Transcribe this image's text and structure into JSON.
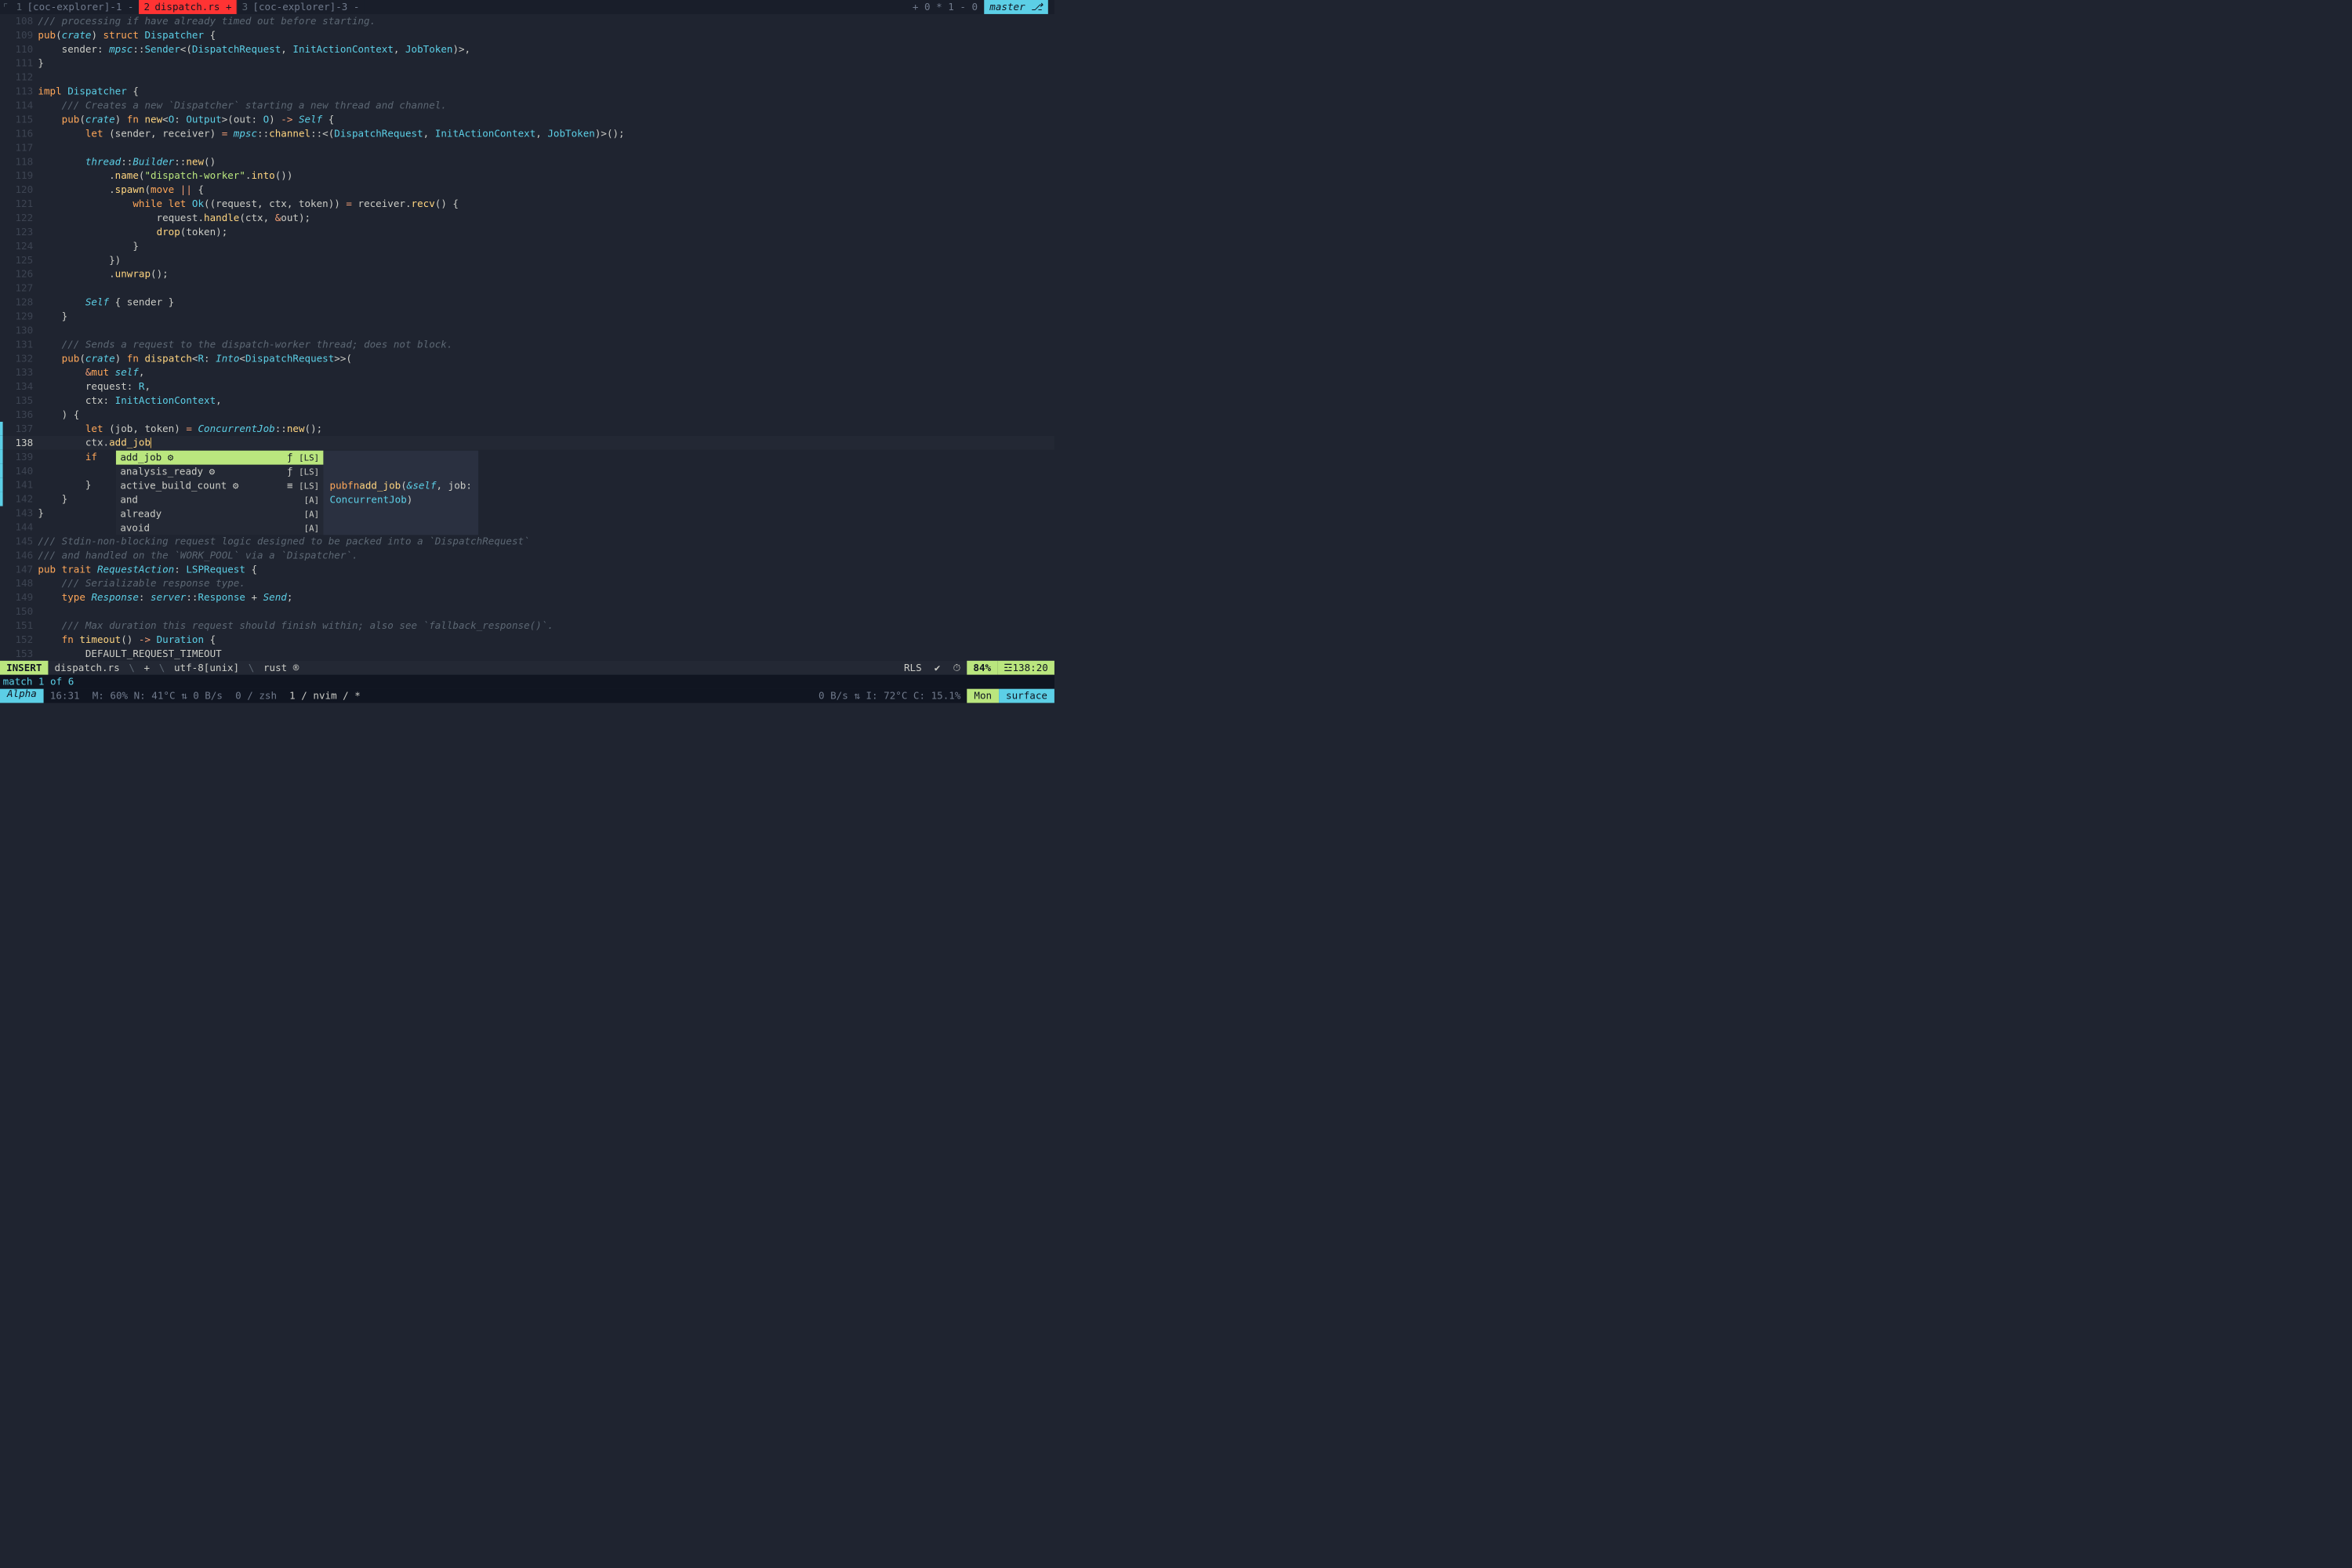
{
  "tabbar": {
    "logo": "⌜",
    "tabs": [
      {
        "num": "1",
        "label": "[coc-explorer]-1 -",
        "active": false
      },
      {
        "num": "2",
        "label": "dispatch.rs +",
        "active": true
      },
      {
        "num": "3",
        "label": "[coc-explorer]-3 -",
        "active": false
      }
    ],
    "rightinfo": "+ 0 * 1 - 0",
    "branch": "master ⎇"
  },
  "gutter_start": 108,
  "current_line": 138,
  "lines": [
    [
      [
        "cm",
        "/// processing if have already timed out before starting."
      ]
    ],
    [
      [
        "kw",
        "pub"
      ],
      [
        "pu",
        "("
      ],
      [
        "em",
        "crate"
      ],
      [
        "pu",
        ") "
      ],
      [
        "kw",
        "struct"
      ],
      [
        "pu",
        " "
      ],
      [
        "ty",
        "Dispatcher"
      ],
      [
        "pu",
        " {"
      ]
    ],
    [
      [
        "pu",
        "    sender: "
      ],
      [
        "em",
        "mpsc"
      ],
      [
        "pu",
        "::"
      ],
      [
        "ty",
        "Sender"
      ],
      [
        "pu",
        "<("
      ],
      [
        "ty",
        "DispatchRequest"
      ],
      [
        "pu",
        ", "
      ],
      [
        "ty",
        "InitActionContext"
      ],
      [
        "pu",
        ", "
      ],
      [
        "ty",
        "JobToken"
      ],
      [
        "pu",
        ")>,"
      ]
    ],
    [
      [
        "pu",
        "}"
      ]
    ],
    [
      [
        "pu",
        ""
      ]
    ],
    [
      [
        "kw",
        "impl"
      ],
      [
        "pu",
        " "
      ],
      [
        "ty",
        "Dispatcher"
      ],
      [
        "pu",
        " {"
      ]
    ],
    [
      [
        "pu",
        "    "
      ],
      [
        "cm",
        "/// Creates a new `Dispatcher` starting a new thread and channel."
      ]
    ],
    [
      [
        "pu",
        "    "
      ],
      [
        "kw",
        "pub"
      ],
      [
        "pu",
        "("
      ],
      [
        "em",
        "crate"
      ],
      [
        "pu",
        ") "
      ],
      [
        "kw",
        "fn"
      ],
      [
        "pu",
        " "
      ],
      [
        "fn",
        "new"
      ],
      [
        "pu",
        "<"
      ],
      [
        "ty",
        "O"
      ],
      [
        "pu",
        ": "
      ],
      [
        "ty",
        "Output"
      ],
      [
        "pu",
        ">(out: "
      ],
      [
        "ty",
        "O"
      ],
      [
        "pu",
        ") "
      ],
      [
        "op",
        "->"
      ],
      [
        "pu",
        " "
      ],
      [
        "se",
        "Self"
      ],
      [
        "pu",
        " {"
      ]
    ],
    [
      [
        "pu",
        "        "
      ],
      [
        "kw",
        "let"
      ],
      [
        "pu",
        " (sender, receiver) "
      ],
      [
        "op",
        "="
      ],
      [
        "pu",
        " "
      ],
      [
        "em",
        "mpsc"
      ],
      [
        "pu",
        "::"
      ],
      [
        "fn",
        "channel"
      ],
      [
        "pu",
        "::<("
      ],
      [
        "ty",
        "DispatchRequest"
      ],
      [
        "pu",
        ", "
      ],
      [
        "ty",
        "InitActionContext"
      ],
      [
        "pu",
        ", "
      ],
      [
        "ty",
        "JobToken"
      ],
      [
        "pu",
        ")>();"
      ]
    ],
    [
      [
        "pu",
        ""
      ]
    ],
    [
      [
        "pu",
        "        "
      ],
      [
        "em",
        "thread"
      ],
      [
        "pu",
        "::"
      ],
      [
        "em",
        "Builder"
      ],
      [
        "pu",
        "::"
      ],
      [
        "fn",
        "new"
      ],
      [
        "pu",
        "()"
      ]
    ],
    [
      [
        "pu",
        "            ."
      ],
      [
        "fn",
        "name"
      ],
      [
        "pu",
        "("
      ],
      [
        "str",
        "\"dispatch-worker\""
      ],
      [
        "pu",
        "."
      ],
      [
        "fn",
        "into"
      ],
      [
        "pu",
        "())"
      ]
    ],
    [
      [
        "pu",
        "            ."
      ],
      [
        "fn",
        "spawn"
      ],
      [
        "pu",
        "("
      ],
      [
        "kw",
        "move"
      ],
      [
        "pu",
        " "
      ],
      [
        "op",
        "||"
      ],
      [
        "pu",
        " {"
      ]
    ],
    [
      [
        "pu",
        "                "
      ],
      [
        "kw",
        "while let"
      ],
      [
        "pu",
        " "
      ],
      [
        "ty",
        "Ok"
      ],
      [
        "pu",
        "((request, ctx, token)) "
      ],
      [
        "op",
        "="
      ],
      [
        "pu",
        " receiver."
      ],
      [
        "fn",
        "recv"
      ],
      [
        "pu",
        "() {"
      ]
    ],
    [
      [
        "pu",
        "                    request."
      ],
      [
        "fn",
        "handle"
      ],
      [
        "pu",
        "(ctx, "
      ],
      [
        "op",
        "&"
      ],
      [
        "pu",
        "out);"
      ]
    ],
    [
      [
        "pu",
        "                    "
      ],
      [
        "fn",
        "drop"
      ],
      [
        "pu",
        "(token);"
      ]
    ],
    [
      [
        "pu",
        "                }"
      ]
    ],
    [
      [
        "pu",
        "            })"
      ]
    ],
    [
      [
        "pu",
        "            ."
      ],
      [
        "fn",
        "unwrap"
      ],
      [
        "pu",
        "();"
      ]
    ],
    [
      [
        "pu",
        ""
      ]
    ],
    [
      [
        "pu",
        "        "
      ],
      [
        "se",
        "Self"
      ],
      [
        "pu",
        " { sender }"
      ]
    ],
    [
      [
        "pu",
        "    }"
      ]
    ],
    [
      [
        "pu",
        ""
      ]
    ],
    [
      [
        "pu",
        "    "
      ],
      [
        "cm",
        "/// Sends a request to the dispatch-worker thread; does not block."
      ]
    ],
    [
      [
        "pu",
        "    "
      ],
      [
        "kw",
        "pub"
      ],
      [
        "pu",
        "("
      ],
      [
        "em",
        "crate"
      ],
      [
        "pu",
        ") "
      ],
      [
        "kw",
        "fn"
      ],
      [
        "pu",
        " "
      ],
      [
        "fn",
        "dispatch"
      ],
      [
        "pu",
        "<"
      ],
      [
        "ty",
        "R"
      ],
      [
        "pu",
        ": "
      ],
      [
        "em",
        "Into"
      ],
      [
        "pu",
        "<"
      ],
      [
        "ty",
        "DispatchRequest"
      ],
      [
        "pu",
        ">>("
      ]
    ],
    [
      [
        "pu",
        "        "
      ],
      [
        "op",
        "&"
      ],
      [
        "kw",
        "mut"
      ],
      [
        "pu",
        " "
      ],
      [
        "se",
        "self"
      ],
      [
        "pu",
        ","
      ]
    ],
    [
      [
        "pu",
        "        request: "
      ],
      [
        "ty",
        "R"
      ],
      [
        "pu",
        ","
      ]
    ],
    [
      [
        "pu",
        "        ctx: "
      ],
      [
        "ty",
        "InitActionContext"
      ],
      [
        "pu",
        ","
      ]
    ],
    [
      [
        "pu",
        "    ) {"
      ]
    ],
    [
      [
        "pu",
        "        "
      ],
      [
        "kw",
        "let"
      ],
      [
        "pu",
        " (job, token) "
      ],
      [
        "op",
        "="
      ],
      [
        "pu",
        " "
      ],
      [
        "em",
        "ConcurrentJob"
      ],
      [
        "pu",
        "::"
      ],
      [
        "fn",
        "new"
      ],
      [
        "pu",
        "();"
      ]
    ],
    [
      [
        "pu",
        "        ctx."
      ],
      [
        "fn",
        "add_job"
      ],
      [
        "cursor",
        ""
      ]
    ],
    [
      [
        "pu",
        "        "
      ],
      [
        "kw",
        "if"
      ],
      [
        "pu",
        " "
      ]
    ],
    [
      [
        "pu",
        ""
      ]
    ],
    [
      [
        "pu",
        "        }"
      ]
    ],
    [
      [
        "pu",
        "    }"
      ]
    ],
    [
      [
        "pu",
        "}"
      ]
    ],
    [
      [
        "pu",
        ""
      ]
    ],
    [
      [
        "cm",
        "/// Stdin-non-blocking request logic designed to be packed into a `DispatchRequest`"
      ]
    ],
    [
      [
        "cm",
        "/// and handled on the `WORK_POOL` via a `Dispatcher`."
      ]
    ],
    [
      [
        "kw",
        "pub trait"
      ],
      [
        "pu",
        " "
      ],
      [
        "em",
        "RequestAction"
      ],
      [
        "pu",
        ": "
      ],
      [
        "ty",
        "LSPRequest"
      ],
      [
        "pu",
        " {"
      ]
    ],
    [
      [
        "pu",
        "    "
      ],
      [
        "cm",
        "/// Serializable response type."
      ]
    ],
    [
      [
        "pu",
        "    "
      ],
      [
        "kw",
        "type"
      ],
      [
        "pu",
        " "
      ],
      [
        "em",
        "Response"
      ],
      [
        "pu",
        ": "
      ],
      [
        "em",
        "server"
      ],
      [
        "pu",
        "::"
      ],
      [
        "ty",
        "Response"
      ],
      [
        "pu",
        " + "
      ],
      [
        "em",
        "Send"
      ],
      [
        "pu",
        ";"
      ]
    ],
    [
      [
        "pu",
        ""
      ]
    ],
    [
      [
        "pu",
        "    "
      ],
      [
        "cm",
        "/// Max duration this request should finish within; also see `fallback_response()`."
      ]
    ],
    [
      [
        "pu",
        "    "
      ],
      [
        "kw",
        "fn"
      ],
      [
        "pu",
        " "
      ],
      [
        "fn",
        "timeout"
      ],
      [
        "pu",
        "() "
      ],
      [
        "op",
        "->"
      ],
      [
        "pu",
        " "
      ],
      [
        "ty",
        "Duration"
      ],
      [
        "pu",
        " {"
      ]
    ],
    [
      [
        "pu",
        "        DEFAULT_REQUEST_TIMEOUT"
      ]
    ]
  ],
  "modified_lines": [
    137,
    138,
    139,
    140,
    141,
    142
  ],
  "popup": {
    "items": [
      {
        "label": "add_job ⚙",
        "kind": "ƒ",
        "src": "[LS]",
        "sel": true
      },
      {
        "label": "analysis_ready ⚙",
        "kind": "ƒ",
        "src": "[LS]",
        "sel": false
      },
      {
        "label": "active_build_count ⚙",
        "kind": "≡",
        "src": "[LS]",
        "sel": false
      },
      {
        "label": "and",
        "kind": "",
        "src": "[A]",
        "sel": false
      },
      {
        "label": "already",
        "kind": "",
        "src": "[A]",
        "sel": false
      },
      {
        "label": "avoid",
        "kind": "",
        "src": "[A]",
        "sel": false
      }
    ],
    "doc": [
      "pub fn add_job(&self, job:",
      "ConcurrentJob)"
    ]
  },
  "statusline": {
    "mode": "INSERT",
    "file": "dispatch.rs",
    "modified": "+",
    "enc": "utf-8[unix]",
    "ft": "rust ®",
    "rls": "RLS",
    "check": "✔",
    "clock": "⏱",
    "pct": "84%",
    "pos": "☲138:20"
  },
  "msgline": "match 1 of 6",
  "tmux": {
    "session": "Alpha",
    "time": "16:31",
    "stats": "M: 60% N: 41°C ⇅ 0 B/s",
    "win0": "0 / zsh",
    "win1": "1 / nvim / *",
    "right_stats": "0 B/s ⇅ I: 72°C C: 15.1%",
    "day": "Mon",
    "host": "surface"
  }
}
